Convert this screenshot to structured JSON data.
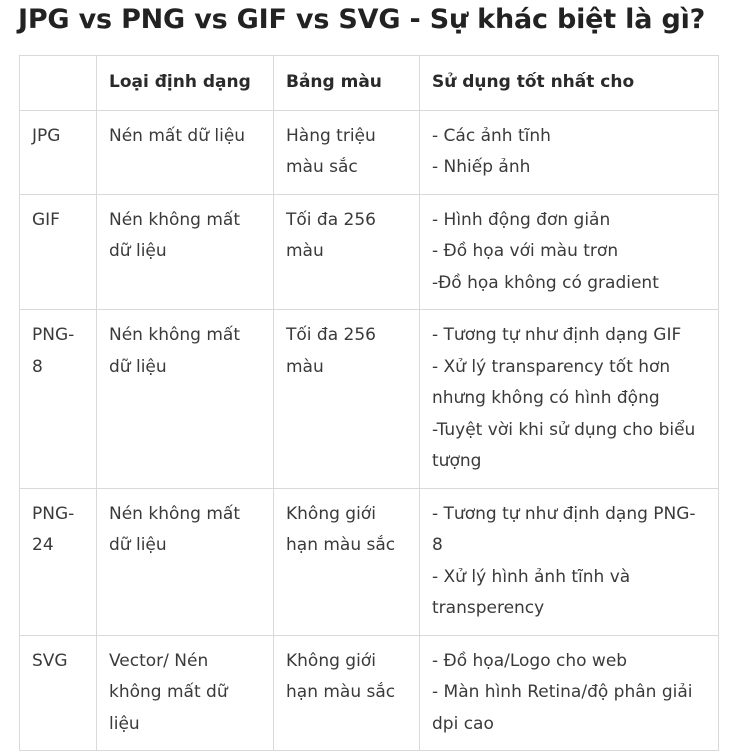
{
  "title": "JPG vs PNG vs GIF vs SVG - Sự khác biệt là gì?",
  "table": {
    "headers": [
      "",
      "Loại định dạng",
      "Bảng màu",
      "Sử dụng tốt nhất cho"
    ],
    "rows": [
      {
        "name": "JPG",
        "type": "Nén mất dữ liệu",
        "palette": "Hàng triệu màu sắc",
        "uses": [
          "- Các ảnh tĩnh",
          "- Nhiếp ảnh"
        ]
      },
      {
        "name": "GIF",
        "type": "Nén không mất dữ liệu",
        "palette": "Tối đa 256 màu",
        "uses": [
          "- Hình động đơn giản",
          "- Đồ họa với màu trơn",
          "-Đồ họa không có gradient"
        ]
      },
      {
        "name": "PNG-8",
        "type": "Nén không mất dữ liệu",
        "palette": "Tối đa 256 màu",
        "uses": [
          "- Tương tự như định dạng GIF",
          "- Xử lý transparency tốt hơn nhưng không có hình động",
          "-Tuyệt vời khi sử dụng cho biểu tượng"
        ]
      },
      {
        "name": "PNG-24",
        "type": "Nén không mất dữ liệu",
        "palette": "Không giới hạn màu sắc",
        "uses": [
          "- Tương tự như định dạng PNG-8",
          "- Xử lý hình ảnh tĩnh và transperency"
        ]
      },
      {
        "name": "SVG",
        "type": "Vector/ Nén không mất dữ liệu",
        "palette": "Không giới hạn màu sắc",
        "uses": [
          "- Đồ họa/Logo cho web",
          "- Màn hình Retina/độ phân giải dpi cao"
        ]
      }
    ]
  }
}
